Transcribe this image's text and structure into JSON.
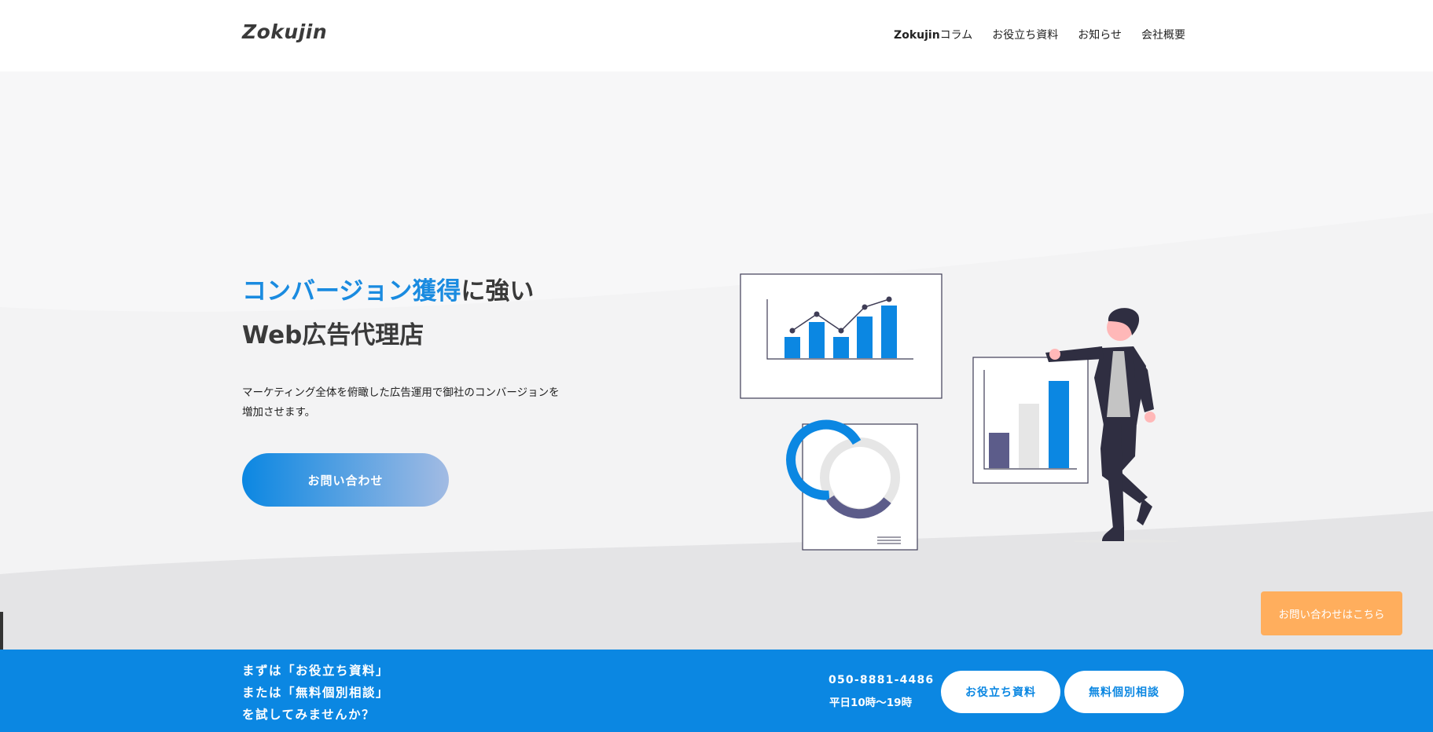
{
  "header": {
    "logo": "Zokujin",
    "nav": [
      {
        "bold": "Zokujin",
        "label": "コラム"
      },
      {
        "bold": "",
        "label": "お役立ち資料"
      },
      {
        "bold": "",
        "label": "お知らせ"
      },
      {
        "bold": "",
        "label": "会社概要"
      }
    ]
  },
  "hero": {
    "headline_accent": "コンバージョン獲得",
    "headline_rest": "に強い",
    "headline_line2": "Web広告代理店",
    "lead_line1": "マーケティング全体を俯瞰した広告運用で御社のコンバージョンを",
    "lead_line2": "増加させます。",
    "cta_label": "お問い合わせ"
  },
  "float_button": "お問い合わせはこちら",
  "bottom_bar": {
    "line1": "まずは「お役立ち資料」",
    "line2": "または「無料個別相談」",
    "line3": "を試してみませんか？",
    "tel": "050-8881-4486",
    "hours": "平日10時～19時",
    "button1": "お役立ち資料",
    "button2": "無料個別相談"
  },
  "colors": {
    "accent": "#0b87e2",
    "float": "#ffae5d",
    "dark": "#2f2e41"
  }
}
